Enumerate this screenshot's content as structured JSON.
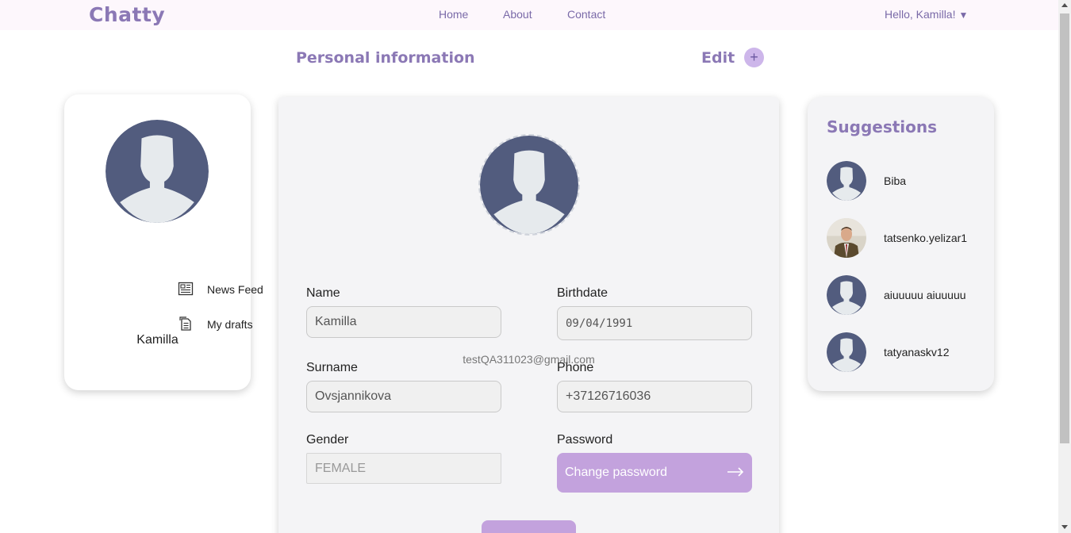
{
  "header": {
    "logo": "Chatty",
    "nav": [
      {
        "label": "Home"
      },
      {
        "label": "About"
      },
      {
        "label": "Contact"
      }
    ],
    "greeting": "Hello, Kamilla!",
    "greeting_caret": "▼"
  },
  "page": {
    "title": "Personal information",
    "edit_label": "Edit",
    "edit_icon": "+"
  },
  "left_panel": {
    "name": "Kamilla",
    "links": [
      {
        "label": "News Feed",
        "icon": "newspaper-icon"
      },
      {
        "label": "My drafts",
        "icon": "document-icon"
      }
    ]
  },
  "profile": {
    "email": "testQA311023@gmail.com",
    "fields": {
      "name_label": "Name",
      "name_value": "Kamilla",
      "surname_label": "Surname",
      "surname_value": "Ovsjannikova",
      "gender_label": "Gender",
      "gender_value": "FEMALE",
      "birthdate_label": "Birthdate",
      "birthdate_value": "09/04/1991",
      "phone_label": "Phone",
      "phone_value": "+37126716036",
      "password_label": "Password",
      "change_password_label": "Change password"
    }
  },
  "suggestions": {
    "title": "Suggestions",
    "items": [
      {
        "name": "Biba",
        "avatar": "default-avatar"
      },
      {
        "name": "tatsenko.yelizar1",
        "avatar": "photo-avatar"
      },
      {
        "name": "aiuuuuu aiuuuuu",
        "avatar": "default-avatar"
      },
      {
        "name": "tatyanaskv12",
        "avatar": "default-avatar"
      }
    ]
  },
  "colors": {
    "accent": "#8b78b5",
    "button": "#c3a2dd",
    "avatar_bg": "#525c7e",
    "avatar_fg": "#e6eaed"
  }
}
